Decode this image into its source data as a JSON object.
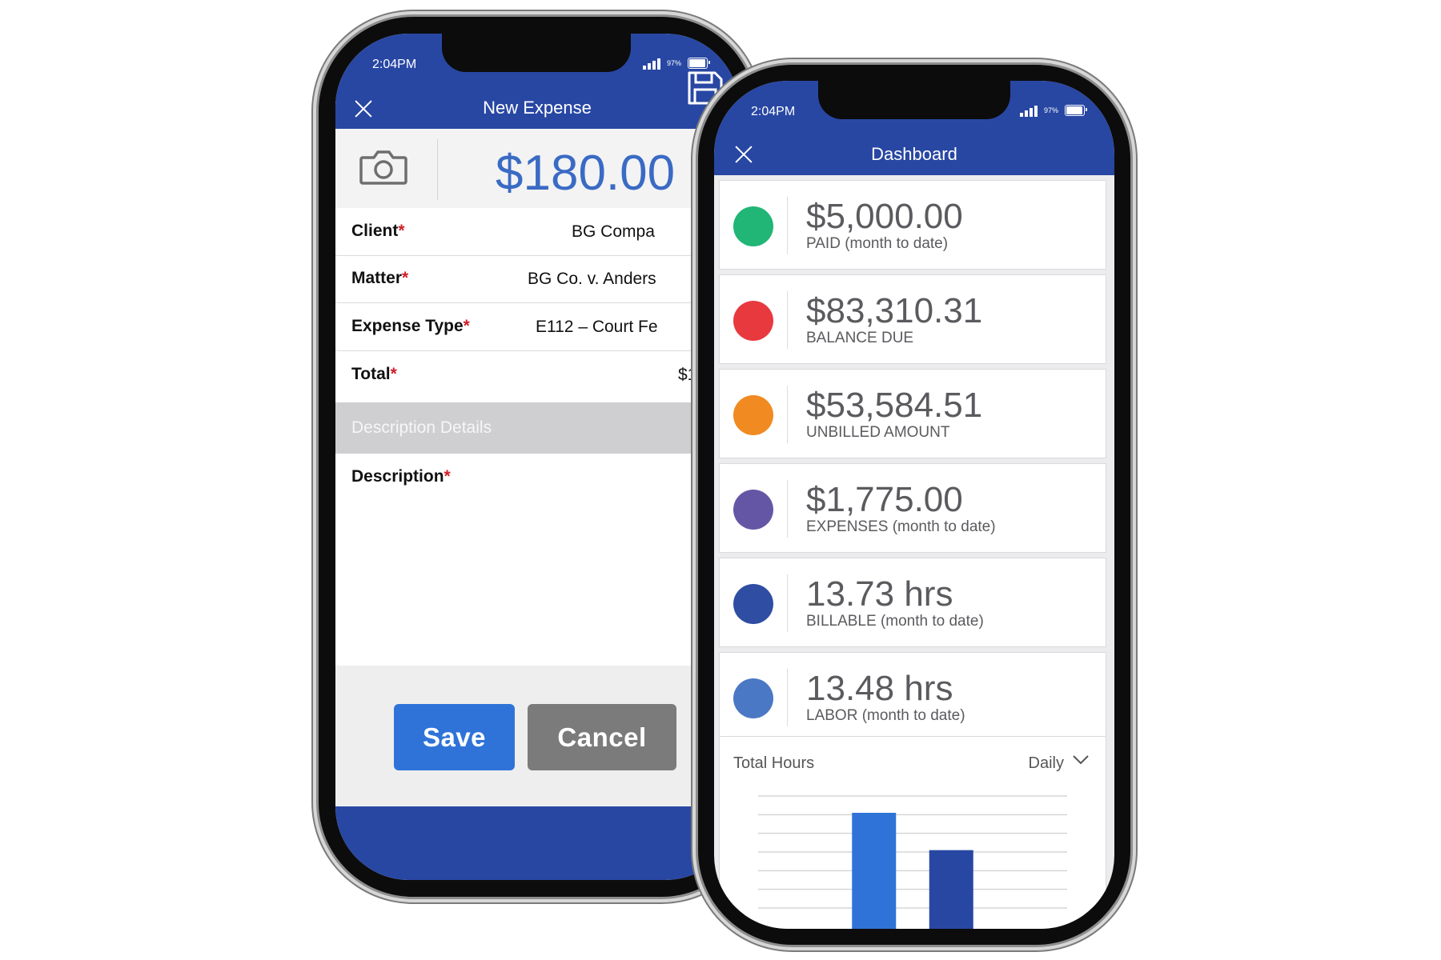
{
  "expense_screen": {
    "status": {
      "time": "2:04PM",
      "battery": "97%"
    },
    "header": {
      "title": "New Expense"
    },
    "amount": "$180.00",
    "fields": [
      {
        "label": "Client",
        "value": "BG Compa"
      },
      {
        "label": "Matter",
        "value": "BG Co. v. Anders"
      },
      {
        "label": "Expense Type",
        "value": "E112 – Court Fe"
      },
      {
        "label": "Total",
        "value": "$1"
      }
    ],
    "required_mark": "*",
    "description_section": "Description Details",
    "description_label": "Description",
    "buttons": {
      "save": "Save",
      "cancel": "Cancel"
    },
    "colors": {
      "brand_blue": "#2847a3",
      "save_button": "#2f73d8",
      "cancel_button": "#7b7b7b",
      "amount_text": "#3a6bc4"
    },
    "icons": [
      "close-icon",
      "camera-icon",
      "save-disk-icon",
      "signal-icon",
      "battery-icon"
    ]
  },
  "dashboard_screen": {
    "status": {
      "time": "2:04PM",
      "battery": "97%"
    },
    "header": {
      "title": "Dashboard"
    },
    "metrics": [
      {
        "value": "$5,000.00",
        "label": "PAID (month to date)",
        "color": "#21b576"
      },
      {
        "value": "$83,310.31",
        "label": "BALANCE DUE",
        "color": "#e8393f"
      },
      {
        "value": "$53,584.51",
        "label": "UNBILLED AMOUNT",
        "color": "#f18a21"
      },
      {
        "value": "$1,775.00",
        "label": "EXPENSES (month to date)",
        "color": "#6556a5"
      },
      {
        "value": "13.73 hrs",
        "label": "BILLABLE (month to date)",
        "color": "#2f4da3"
      },
      {
        "value": "13.48 hrs",
        "label": "LABOR (month to date)",
        "color": "#4a78c4"
      }
    ],
    "chart": {
      "title": "Total Hours",
      "period": "Daily",
      "icons": [
        "chevron-down-icon"
      ]
    }
  },
  "chart_data": {
    "type": "bar",
    "title": "Total Hours",
    "categories": [
      "",
      "",
      "",
      ""
    ],
    "values": [
      0,
      5.1,
      3.1,
      0
    ],
    "colors": [
      "#2f73d8",
      "#2f73d8",
      "#2847a3",
      "#2847a3"
    ],
    "ylim": [
      0,
      6
    ],
    "grid": true
  }
}
